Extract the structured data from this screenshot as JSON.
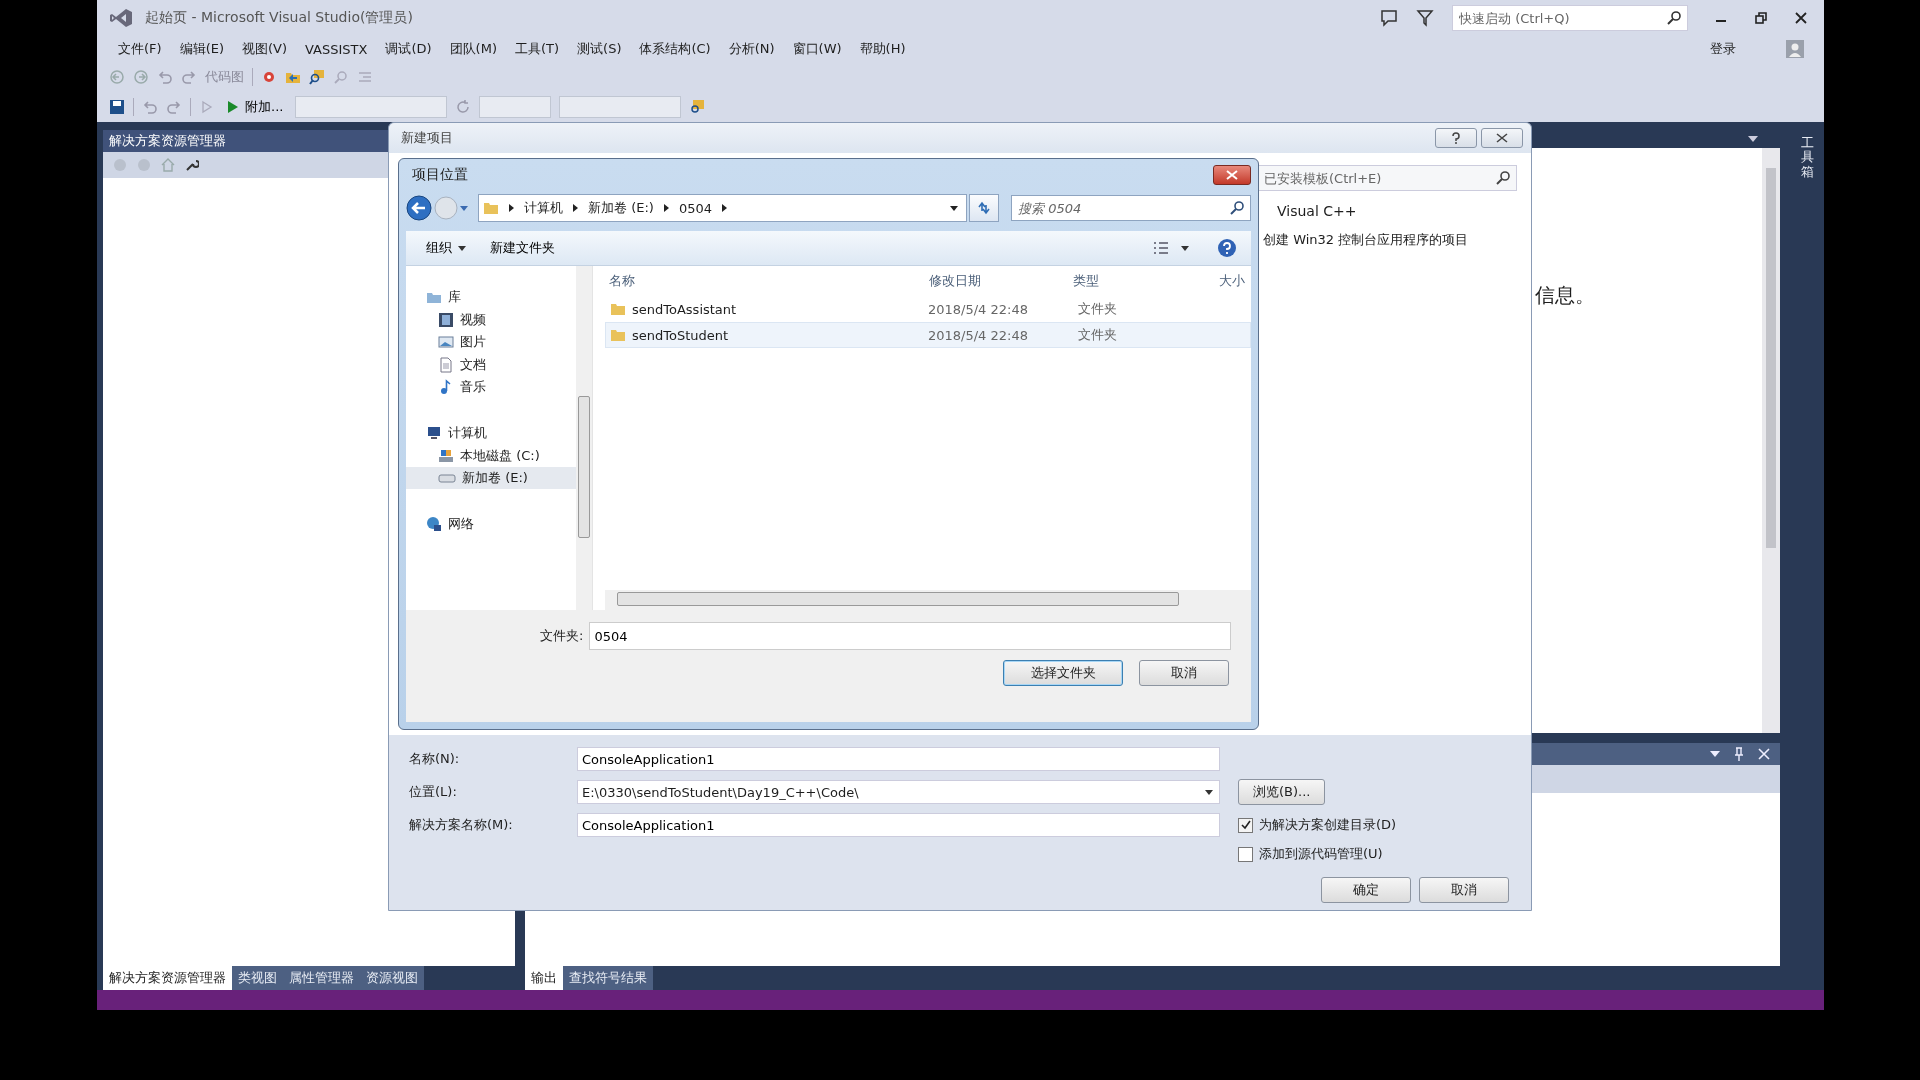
{
  "window": {
    "title": "起始页 - Microsoft Visual Studio(管理员)",
    "quick_launch": {
      "placeholder": "快速启动 (Ctrl+Q)"
    },
    "sign_in": "登录"
  },
  "menu": [
    "文件(F)",
    "编辑(E)",
    "视图(V)",
    "VASSISTX",
    "调试(D)",
    "团队(M)",
    "工具(T)",
    "测试(S)",
    "体系结构(C)",
    "分析(N)",
    "窗口(W)",
    "帮助(H)"
  ],
  "toolbar": {
    "code_map": "代码图",
    "attach": "附加..."
  },
  "solution_explorer": {
    "title": "解决方案资源管理器"
  },
  "left_tabs": [
    {
      "label": "解决方案资源管理器",
      "selected": true
    },
    {
      "label": "类视图",
      "selected": false
    },
    {
      "label": "属性管理器",
      "selected": false
    },
    {
      "label": "资源视图",
      "selected": false
    }
  ],
  "start_page": {
    "text": "信息。"
  },
  "output_tabs": [
    {
      "label": "输出",
      "selected": true
    },
    {
      "label": "查找符号结果",
      "selected": false
    }
  ],
  "toolbox_tab": "工具箱",
  "new_project": {
    "title": "新建项目",
    "template_search": {
      "placeholder": "已安装模板(Ctrl+E)"
    },
    "type_value": "Visual C++",
    "description": "创建 Win32 控制台应用程序的项目",
    "fields": [
      {
        "label": "名称(N):",
        "value": "ConsoleApplication1",
        "kind": "text"
      },
      {
        "label": "位置(L):",
        "value": "E:\\0330\\sendToStudent\\Day19_C++\\Code\\",
        "kind": "combo"
      },
      {
        "label": "解决方案名称(M):",
        "value": "ConsoleApplication1",
        "kind": "text"
      }
    ],
    "browse": "浏览(B)...",
    "options": [
      {
        "label": "为解决方案创建目录(D)",
        "checked": true
      },
      {
        "label": "添加到源代码管理(U)",
        "checked": false
      }
    ],
    "buttons": [
      "确定",
      "取消"
    ]
  },
  "folder_dialog": {
    "title": "项目位置",
    "breadcrumb": [
      "计算机",
      "新加卷 (E:)",
      "0504"
    ],
    "search": {
      "placeholder": "搜索 0504"
    },
    "organize": "组织",
    "new_folder": "新建文件夹",
    "nav": [
      {
        "label": "库",
        "kind": "library",
        "selected": false,
        "children": [
          {
            "label": "视频",
            "kind": "video",
            "selected": false
          },
          {
            "label": "图片",
            "kind": "picture",
            "selected": false
          },
          {
            "label": "文档",
            "kind": "document",
            "selected": false
          },
          {
            "label": "音乐",
            "kind": "music",
            "selected": false
          }
        ]
      },
      {
        "label": "计算机",
        "kind": "computer",
        "selected": false,
        "children": [
          {
            "label": "本地磁盘 (C:)",
            "kind": "disk",
            "selected": false
          },
          {
            "label": "新加卷 (E:)",
            "kind": "drive",
            "selected": true
          }
        ]
      },
      {
        "label": "网络",
        "kind": "network",
        "selected": false
      }
    ],
    "columns": [
      "名称",
      "修改日期",
      "类型",
      "大小"
    ],
    "rows": [
      {
        "name": "sendToAssistant",
        "date": "2018/5/4 22:48",
        "type": "文件夹",
        "hovered": false
      },
      {
        "name": "sendToStudent",
        "date": "2018/5/4 22:48",
        "type": "文件夹",
        "hovered": true
      }
    ],
    "folder_field": {
      "label": "文件夹:",
      "value": "0504"
    },
    "buttons": [
      "选择文件夹",
      "取消"
    ]
  }
}
